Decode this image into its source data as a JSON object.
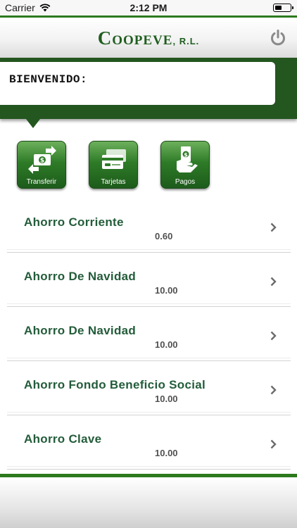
{
  "status_bar": {
    "carrier": "Carrier",
    "time": "2:12 PM"
  },
  "header": {
    "brand_main": "Coopeve",
    "brand_suffix": ", R.L.",
    "power_icon": "power-icon"
  },
  "welcome": {
    "label": "BIENVENIDO:"
  },
  "actions": [
    {
      "label": "Transferir",
      "icon": "transfer-money-icon"
    },
    {
      "label": "Tarjetas",
      "icon": "cards-icon"
    },
    {
      "label": "Pagos",
      "icon": "payment-hand-icon"
    }
  ],
  "accounts": [
    {
      "name": "Ahorro Corriente",
      "amount": "0.60"
    },
    {
      "name": "Ahorro De Navidad",
      "amount": "10.00"
    },
    {
      "name": "Ahorro De Navidad",
      "amount": "10.00"
    },
    {
      "name": "Ahorro Fondo Beneficio Social",
      "amount": "10.00"
    },
    {
      "name": "Ahorro Clave",
      "amount": "10.00"
    }
  ],
  "colors": {
    "brand_green": "#24561f",
    "accent_green": "#2d7a1e",
    "account_text": "#235c3a"
  }
}
